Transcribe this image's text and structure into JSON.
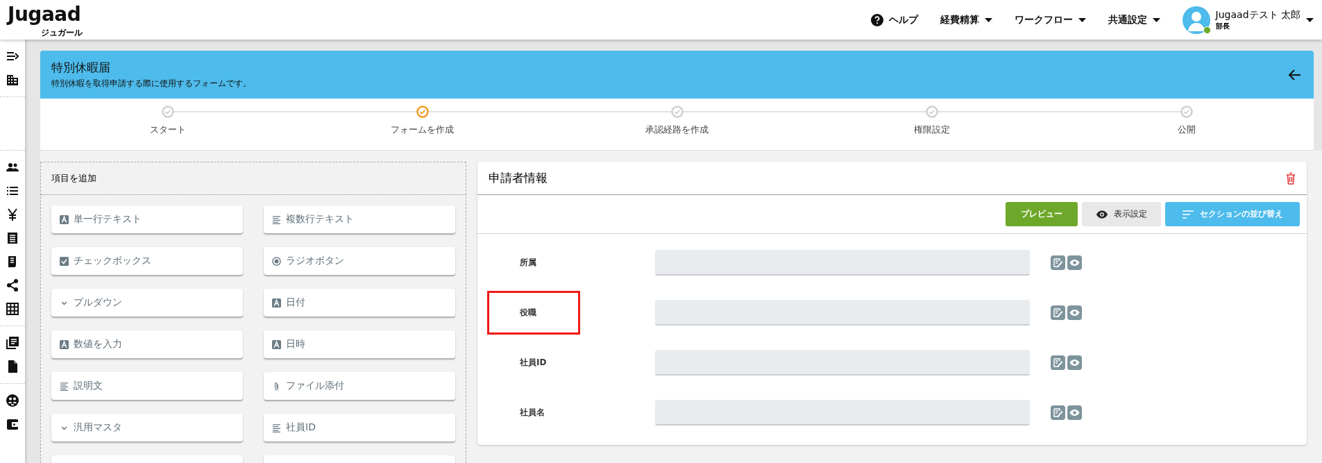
{
  "header": {
    "logo": {
      "text": "Jugaad",
      "subtitle": "ジュガール"
    },
    "help": "ヘルプ",
    "menus": [
      "経費精算",
      "ワークフロー",
      "共通設定"
    ],
    "user": {
      "name": "Jugaadテスト 太郎",
      "role": "部長",
      "online": true
    }
  },
  "form_banner": {
    "title": "特別休暇届",
    "description": "特別休暇を取得申請する際に使用するフォームです。"
  },
  "steps": [
    {
      "label": "スタート",
      "current": false
    },
    {
      "label": "フォームを作成",
      "current": true
    },
    {
      "label": "承認経路を作成",
      "current": false
    },
    {
      "label": "権限設定",
      "current": false
    },
    {
      "label": "公開",
      "current": false
    }
  ],
  "palette": {
    "title": "項目を追加",
    "items": [
      {
        "label": "単一行テキスト",
        "kind": "text"
      },
      {
        "label": "複数行テキスト",
        "kind": "lines"
      },
      {
        "label": "チェックボックス",
        "kind": "checkbox"
      },
      {
        "label": "ラジオボタン",
        "kind": "radio"
      },
      {
        "label": "プルダウン",
        "kind": "dropdown"
      },
      {
        "label": "日付",
        "kind": "text"
      },
      {
        "label": "数値を入力",
        "kind": "text"
      },
      {
        "label": "日時",
        "kind": "text"
      },
      {
        "label": "説明文",
        "kind": "lines"
      },
      {
        "label": "ファイル添付",
        "kind": "file"
      },
      {
        "label": "汎用マスタ",
        "kind": "dropdown"
      },
      {
        "label": "社員ID",
        "kind": "lines"
      }
    ]
  },
  "section": {
    "title": "申請者情報",
    "buttons": [
      {
        "label": "プレビュー",
        "kind": "preview"
      },
      {
        "label": "表示設定",
        "kind": "display"
      },
      {
        "label": "セクションの並び替え",
        "kind": "sort"
      }
    ],
    "fields": [
      {
        "label": "所属",
        "highlighted": false
      },
      {
        "label": "役職",
        "highlighted": true
      },
      {
        "label": "社員ID",
        "highlighted": false
      },
      {
        "label": "社員名",
        "highlighted": false
      }
    ]
  }
}
